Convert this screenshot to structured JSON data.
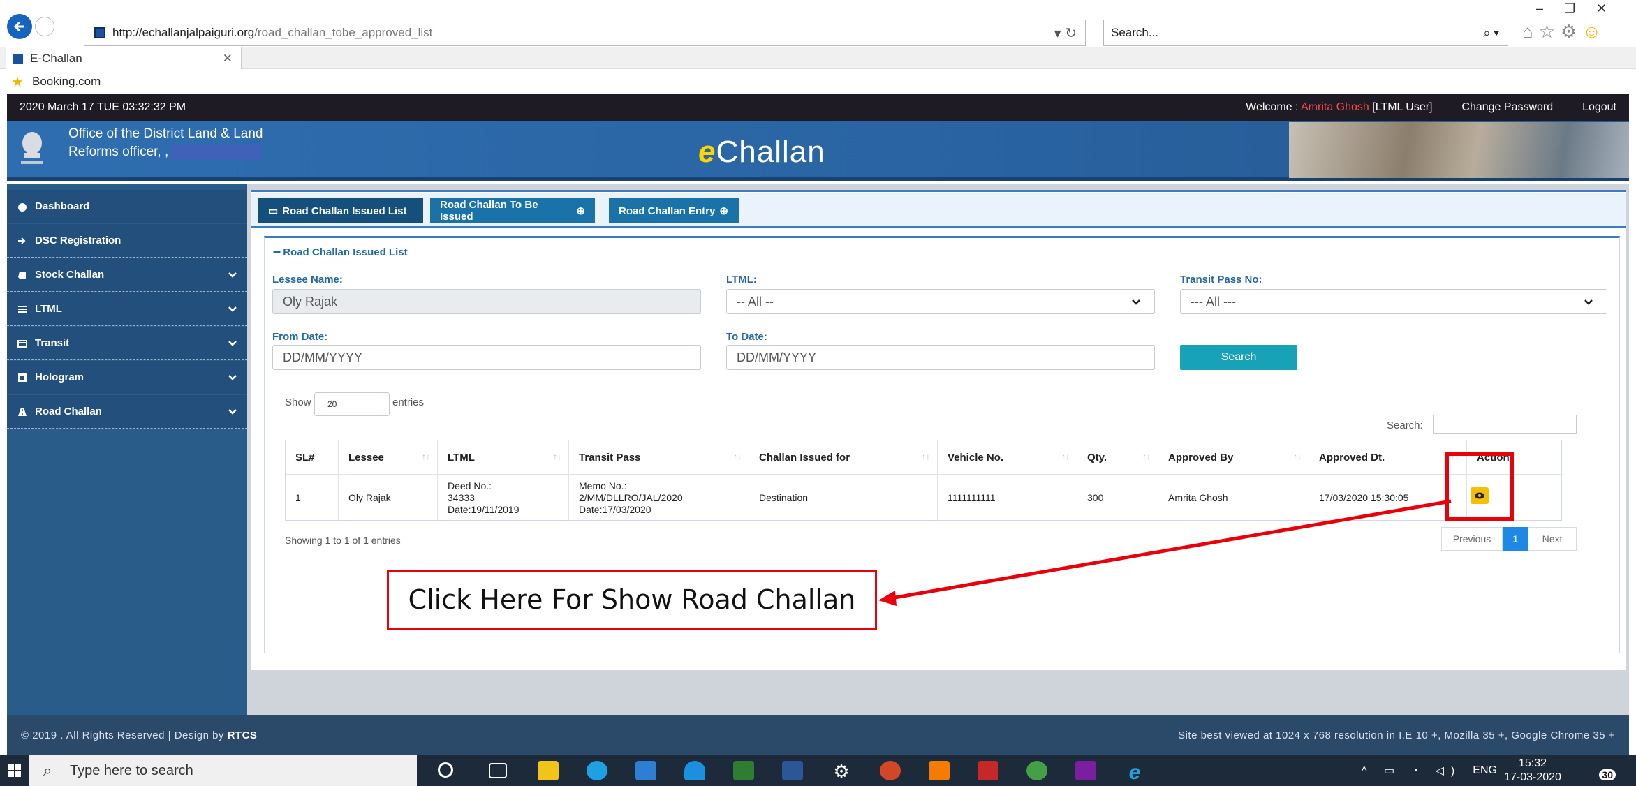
{
  "browser": {
    "url_domain": "http://echallanjalpaiguri.org",
    "url_path": "/road_challan_tobe_approved_list",
    "search_placeholder": "Search...",
    "tab_title": "E-Challan",
    "favorite": "Booking.com"
  },
  "topbar": {
    "datetime": "2020 March 17 TUE  03:32:32 PM",
    "welcome_prefix": "Welcome : ",
    "user_name": "Amrita Ghosh",
    "user_role": " [LTML User]",
    "change_password": "Change Password",
    "logout": "Logout"
  },
  "header": {
    "office_line1": "Office of the District Land & Land",
    "office_line2": "Reforms officer, ,",
    "brand_e": "e",
    "brand_rest": "Challan"
  },
  "sidebar": {
    "items": [
      {
        "label": "Dashboard",
        "icon": "dashboard-icon"
      },
      {
        "label": "DSC Registration",
        "icon": "sign-in-icon"
      },
      {
        "label": "Stock Challan",
        "icon": "book-icon"
      },
      {
        "label": "LTML",
        "icon": "list-icon"
      },
      {
        "label": "Transit",
        "icon": "card-icon"
      },
      {
        "label": "Hologram",
        "icon": "hologram-icon"
      },
      {
        "label": "Road Challan",
        "icon": "road-icon"
      }
    ]
  },
  "tabs": {
    "issued_list": "Road Challan Issued List",
    "to_be_issued": "Road Challan To Be Issued",
    "entry": "Road Challan Entry"
  },
  "section_title": "Road Challan Issued List",
  "filters": {
    "lessee_label": "Lessee Name:",
    "lessee_value": "Oly Rajak",
    "ltml_label": "LTML:",
    "ltml_value": "-- All --",
    "transit_label": "Transit Pass No:",
    "transit_value": "--- All ---",
    "from_label": "From Date:",
    "from_placeholder": "DD/MM/YYYY",
    "to_label": "To Date:",
    "to_placeholder": "DD/MM/YYYY",
    "search_button": "Search"
  },
  "datatable": {
    "show_label": "Show",
    "page_length": "20",
    "entries_label": "entries",
    "search_label": "Search:",
    "columns": [
      "SL#",
      "Lessee",
      "LTML",
      "Transit Pass",
      "Challan Issued for",
      "Vehicle No.",
      "Qty.",
      "Approved By",
      "Approved Dt.",
      "Action"
    ],
    "row": {
      "sl": "1",
      "lessee": "Oly Rajak",
      "ltml_1": "Deed No.:",
      "ltml_2": "34333",
      "ltml_3": "Date:19/11/2019",
      "transit_1": "Memo No.:",
      "transit_2": "2/MM/DLLRO/JAL/2020",
      "transit_3": "Date:17/03/2020",
      "issued_for": "Destination",
      "vehicle": "1111111111",
      "qty": "300",
      "approved_by": "Amrita Ghosh",
      "approved_dt": "17/03/2020 15:30:05"
    },
    "info": "Showing 1 to 1 of 1 entries",
    "prev": "Previous",
    "page": "1",
    "next": "Next"
  },
  "annotation": "Click Here For Show Road Challan",
  "footer": {
    "left_prefix": "© 2019 . All Rights Reserved | Design by ",
    "left_brand": "RTCS",
    "right": "Site best viewed at 1024 x 768 resolution in I.E 10 +, Mozilla 35 +, Google Chrome 35 +"
  },
  "taskbar": {
    "search_placeholder": "Type here to search",
    "lang": "ENG",
    "time": "15:32",
    "date": "17-03-2020",
    "notifications": "30"
  }
}
